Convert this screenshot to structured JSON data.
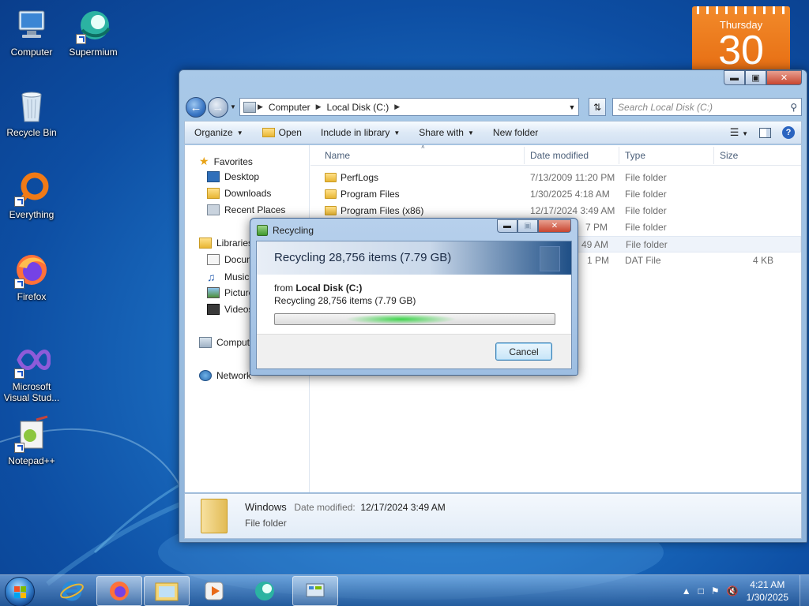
{
  "desktop": {
    "icons": [
      {
        "label": "Computer"
      },
      {
        "label": "Supermium"
      },
      {
        "label": "Recycle Bin"
      },
      {
        "label": "Everything"
      },
      {
        "label": "Firefox"
      },
      {
        "label": "Microsoft Visual Stud..."
      },
      {
        "label": "Notepad++"
      }
    ]
  },
  "calendar": {
    "weekday": "Thursday",
    "day": "30"
  },
  "explorer": {
    "address": {
      "crumbs": [
        "Computer",
        "Local Disk (C:)"
      ]
    },
    "search_placeholder": "Search Local Disk (C:)",
    "toolbar": {
      "organize": "Organize",
      "open": "Open",
      "include": "Include in library",
      "share": "Share with",
      "new_folder": "New folder"
    },
    "nav_pane": {
      "favorites": "Favorites",
      "desktop": "Desktop",
      "downloads": "Downloads",
      "recent": "Recent Places",
      "libraries": "Libraries",
      "documents": "Docum",
      "music": "Music",
      "pictures": "Picture",
      "videos": "Videos",
      "computer": "Comput",
      "network": "Network"
    },
    "columns": {
      "name": "Name",
      "date": "Date modified",
      "type": "Type",
      "size": "Size"
    },
    "rows": [
      {
        "name": "PerfLogs",
        "date": "7/13/2009 11:20 PM",
        "type": "File folder",
        "size": ""
      },
      {
        "name": "Program Files",
        "date": "1/30/2025 4:18 AM",
        "type": "File folder",
        "size": ""
      },
      {
        "name": "Program Files (x86)",
        "date": "12/17/2024 3:49 AM",
        "type": "File folder",
        "size": ""
      },
      {
        "name": "",
        "date": "7 PM",
        "type": "File folder",
        "size": ""
      },
      {
        "name": "",
        "date": "49 AM",
        "type": "File folder",
        "size": ""
      },
      {
        "name": "",
        "date": "1 PM",
        "type": "DAT File",
        "size": "4 KB"
      }
    ],
    "details": {
      "name": "Windows",
      "modified_label": "Date modified:",
      "modified_value": "12/17/2024 3:49 AM",
      "type": "File folder"
    }
  },
  "dialog": {
    "title": "Recycling",
    "header": "Recycling 28,756 items (7.79 GB)",
    "from_prefix": "from",
    "from_location": "Local Disk (C:)",
    "status": "Recycling 28,756 items (7.79 GB)",
    "progress": 0.5,
    "cancel": "Cancel"
  },
  "taskbar": {
    "time": "4:21 AM",
    "date": "1/30/2025"
  }
}
